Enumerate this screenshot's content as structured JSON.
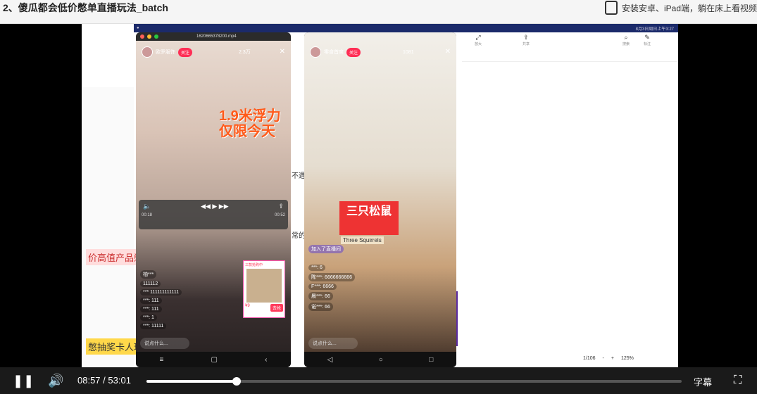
{
  "header": {
    "title": "2、傻瓜都会低价憋单直播玩法_batch",
    "promo_text": "安装安卓、iPad端，躺在床上看视频"
  },
  "video": {
    "mac_menubar_right": "8月3日周日上午3:27",
    "file_name": "1620665378200.mp4",
    "toolbar": [
      {
        "icon": "expand-icon",
        "label": "放大"
      },
      {
        "icon": "share-icon",
        "label": "共享"
      },
      {
        "icon": "search-icon",
        "label": "搜索"
      },
      {
        "icon": "pen-icon",
        "label": "标注"
      }
    ],
    "doc_status": [
      "1/106",
      "-",
      "+",
      "125%"
    ],
    "side_labels": [
      "不遇",
      "常的"
    ],
    "bubbles": [
      "价高值产品憋",
      "憋抽奖卡人玩"
    ],
    "phone1": {
      "host_name": "欧罗服饰",
      "follow_label": "关注",
      "viewer_count": "2.3万",
      "overlay_line1": "1.9米浮力",
      "overlay_line2": "仅限今天",
      "player_time_left": "00:18",
      "player_time_right": "00:52",
      "comments": [
        "柚***",
        "111112",
        "*** 111111111111",
        "***: 111",
        "***: 111",
        "***: 1",
        "***: 11111"
      ],
      "product_header": "三款抢购中",
      "product_price": "¥9",
      "product_buy": "去抢",
      "input_placeholder": "说点什么..."
    },
    "phone2": {
      "host_name": "零食首席",
      "follow_label": "关注",
      "viewer_count": "1081",
      "brand": "三只松鼠",
      "brand_sub": "Three Squirrels",
      "join_text": "加入了直播间",
      "comments": [
        "***: 6",
        "陈***: 6666666666",
        "F***: 6666",
        "晨***: 66",
        "诺***: 66"
      ],
      "input_placeholder": "说点什么..."
    }
  },
  "controls": {
    "current_time": "08:57",
    "separator": "/",
    "total_time": "53:01",
    "progress": 0.169,
    "subtitles_label": "字幕",
    "play_state": "playing"
  }
}
